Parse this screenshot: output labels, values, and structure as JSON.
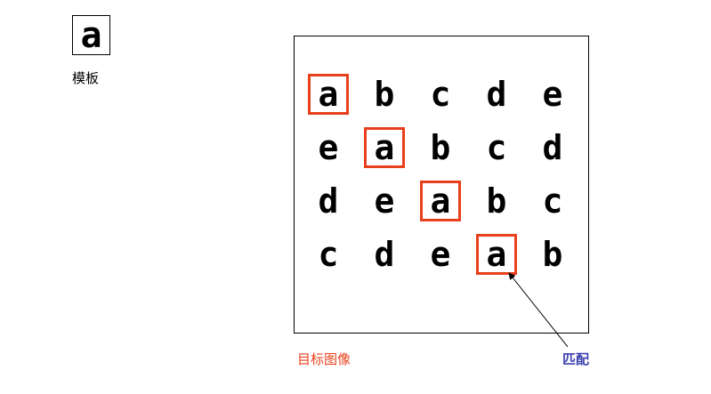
{
  "template": {
    "glyph": "a",
    "label": "模板"
  },
  "target": {
    "label": "目标图像",
    "rows": [
      [
        "a",
        "b",
        "c",
        "d",
        "e"
      ],
      [
        "e",
        "a",
        "b",
        "c",
        "d"
      ],
      [
        "d",
        "e",
        "a",
        "b",
        "c"
      ],
      [
        "c",
        "d",
        "e",
        "a",
        "b"
      ]
    ],
    "matches": [
      [
        0,
        0
      ],
      [
        1,
        1
      ],
      [
        2,
        2
      ],
      [
        3,
        3
      ]
    ]
  },
  "annotation": {
    "label": "匹配",
    "arrow_points_to_match": [
      3,
      3
    ]
  },
  "colors": {
    "match_box": "#e8401c",
    "target_label": "#e8401c",
    "match_label": "#3b3fb0",
    "glyph": "#000000"
  }
}
